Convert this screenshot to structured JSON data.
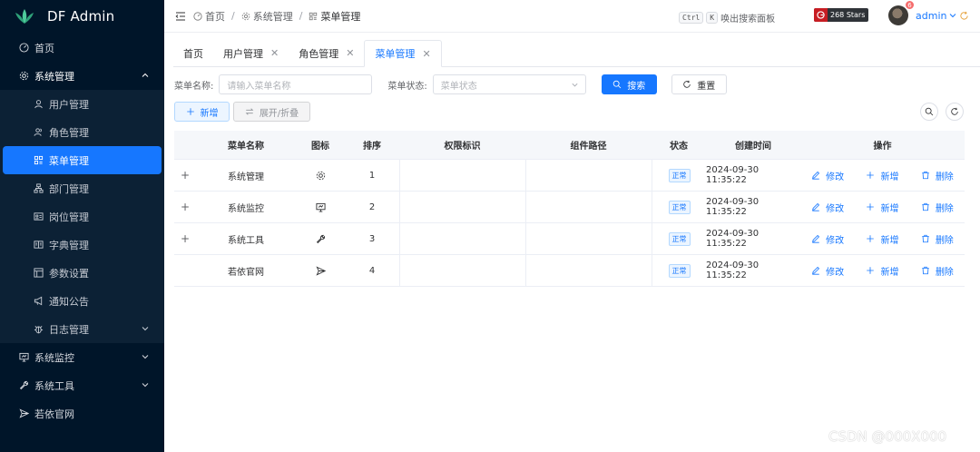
{
  "app": {
    "title": "DF Admin"
  },
  "sidebar": {
    "items": [
      {
        "label": "首页"
      },
      {
        "label": "系统管理",
        "children": [
          {
            "label": "用户管理"
          },
          {
            "label": "角色管理"
          },
          {
            "label": "菜单管理",
            "active": true
          },
          {
            "label": "部门管理"
          },
          {
            "label": "岗位管理"
          },
          {
            "label": "字典管理"
          },
          {
            "label": "参数设置"
          },
          {
            "label": "通知公告"
          },
          {
            "label": "日志管理"
          }
        ]
      },
      {
        "label": "系统监控"
      },
      {
        "label": "系统工具"
      },
      {
        "label": "若依官网"
      }
    ]
  },
  "header": {
    "breadcrumbs": [
      "首页",
      "系统管理",
      "菜单管理"
    ],
    "search_key1": "Ctrl",
    "search_key2": "K",
    "search_hint": "唤出搜索面板",
    "stars": "268 Stars",
    "badge": "6",
    "username": "admin"
  },
  "tabs": [
    {
      "label": "首页",
      "closable": false
    },
    {
      "label": "用户管理",
      "closable": true
    },
    {
      "label": "角色管理",
      "closable": true
    },
    {
      "label": "菜单管理",
      "closable": true,
      "active": true
    }
  ],
  "filter": {
    "name_label": "菜单名称:",
    "name_placeholder": "请输入菜单名称",
    "status_label": "菜单状态:",
    "status_placeholder": "菜单状态",
    "search_btn": "搜索",
    "reset_btn": "重置"
  },
  "toolbar": {
    "add_btn": "新增",
    "expand_btn": "展开/折叠"
  },
  "table": {
    "headers": [
      "菜单名称",
      "图标",
      "排序",
      "权限标识",
      "组件路径",
      "状态",
      "创建时间",
      "操作"
    ],
    "rows": [
      {
        "expandable": "+",
        "name": "系统管理",
        "icon": "gear-icon",
        "order": "1",
        "perm": "",
        "path": "",
        "status": "正常",
        "created": "2024-09-30 11:35:22"
      },
      {
        "expandable": "+",
        "name": "系统监控",
        "icon": "monitor-icon",
        "order": "2",
        "perm": "",
        "path": "",
        "status": "正常",
        "created": "2024-09-30 11:35:22"
      },
      {
        "expandable": "+",
        "name": "系统工具",
        "icon": "wrench-icon",
        "order": "3",
        "perm": "",
        "path": "",
        "status": "正常",
        "created": "2024-09-30 11:35:22"
      },
      {
        "expandable": "",
        "name": "若依官网",
        "icon": "send-icon",
        "order": "4",
        "perm": "",
        "path": "",
        "status": "正常",
        "created": "2024-09-30 11:35:22"
      }
    ],
    "ops": {
      "edit": "修改",
      "add": "新增",
      "delete": "删除"
    }
  },
  "watermark": "CSDN @000X000",
  "colors": {
    "sidebar_bg": "#001529",
    "accent": "#1677ff"
  }
}
